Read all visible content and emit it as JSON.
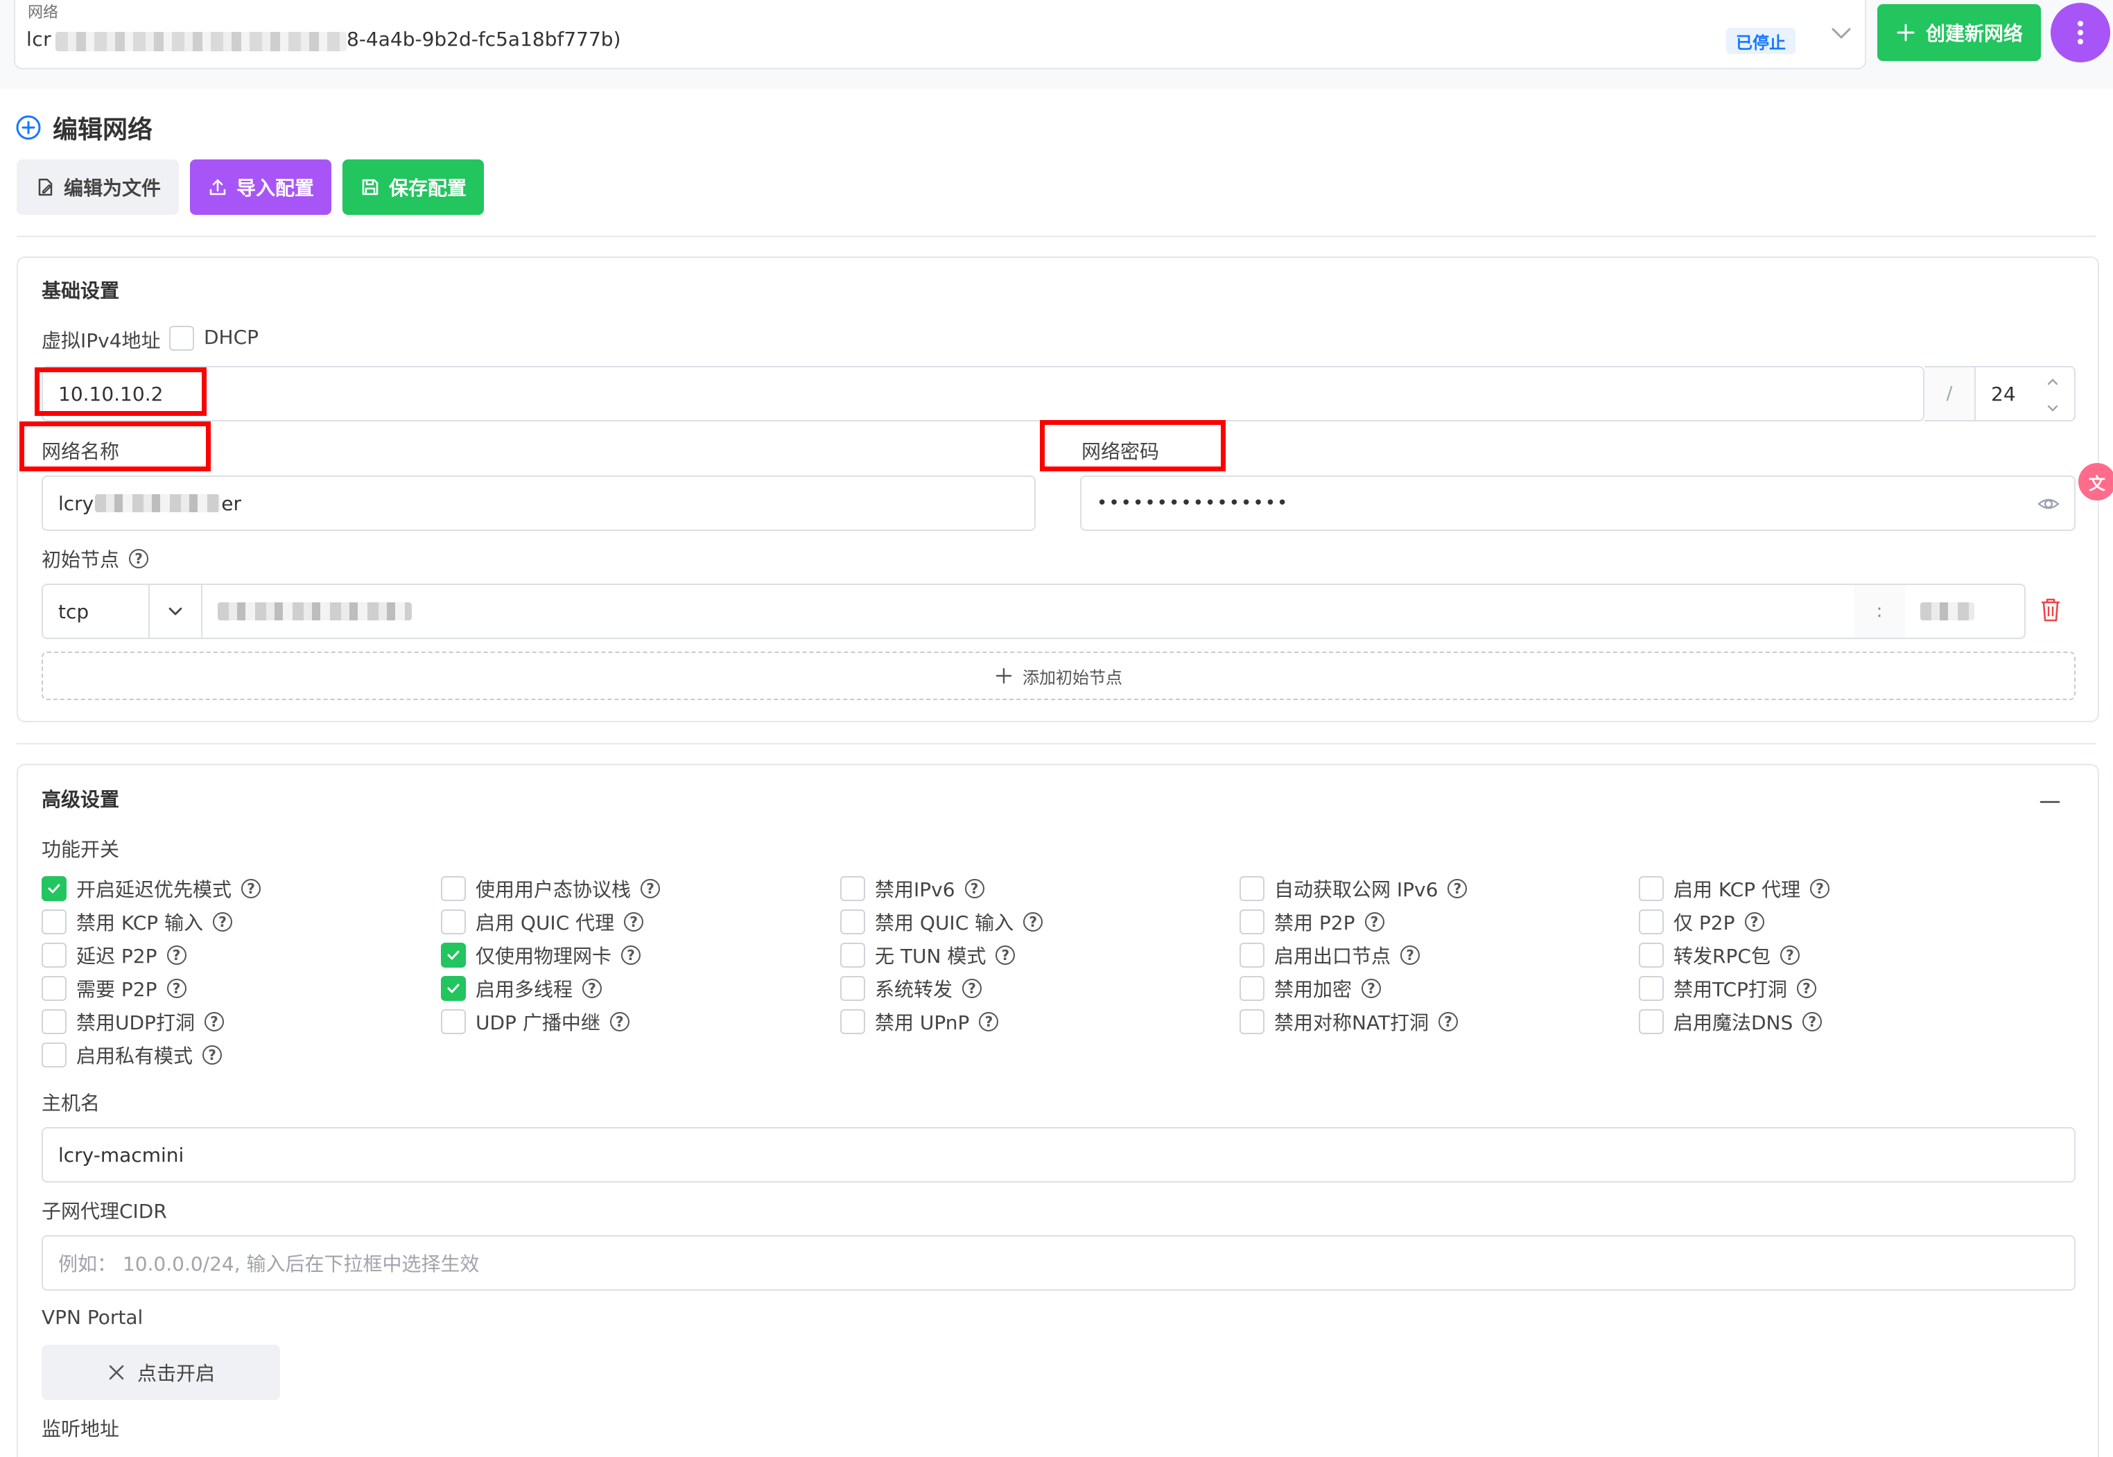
{
  "network_bar": {
    "label": "网络",
    "value_prefix": "lcr",
    "value_suffix": "8-4a4b-9b2d-fc5a18bf777b)",
    "status": "已停止",
    "create_button": "创建新网络"
  },
  "edit": {
    "title": "编辑网络",
    "edit_as_file": "编辑为文件",
    "import_config": "导入配置",
    "save_config": "保存配置"
  },
  "basic": {
    "title": "基础设置",
    "ipv4_label": "虚拟IPv4地址",
    "dhcp_label": "DHCP",
    "ipv4_value": "10.10.10.2",
    "slash": "/",
    "prefix_value": "24",
    "network_name_label": "网络名称",
    "network_name_prefix": "lcry",
    "network_name_suffix": "er",
    "network_password_label": "网络密码",
    "network_password_value": "••••••••••••••••",
    "initial_node_label": "初始节点",
    "protocol_value": "tcp",
    "colon": ":",
    "add_node": "添加初始节点"
  },
  "advanced": {
    "title": "高级设置",
    "feature_label": "功能开关",
    "features": [
      {
        "label": "开启延迟优先模式",
        "checked": true
      },
      {
        "label": "使用用户态协议栈",
        "checked": false
      },
      {
        "label": "禁用IPv6",
        "checked": false
      },
      {
        "label": "自动获取公网 IPv6",
        "checked": false
      },
      {
        "label": "启用 KCP 代理",
        "checked": false
      },
      {
        "label": "禁用 KCP 输入",
        "checked": false
      },
      {
        "label": "启用 QUIC 代理",
        "checked": false
      },
      {
        "label": "禁用 QUIC 输入",
        "checked": false
      },
      {
        "label": "禁用 P2P",
        "checked": false
      },
      {
        "label": "仅 P2P",
        "checked": false
      },
      {
        "label": "延迟 P2P",
        "checked": false
      },
      {
        "label": "仅使用物理网卡",
        "checked": true
      },
      {
        "label": "无 TUN 模式",
        "checked": false
      },
      {
        "label": "启用出口节点",
        "checked": false
      },
      {
        "label": "转发RPC包",
        "checked": false
      },
      {
        "label": "需要 P2P",
        "checked": false
      },
      {
        "label": "启用多线程",
        "checked": true
      },
      {
        "label": "系统转发",
        "checked": false
      },
      {
        "label": "禁用加密",
        "checked": false
      },
      {
        "label": "禁用TCP打洞",
        "checked": false
      },
      {
        "label": "禁用UDP打洞",
        "checked": false
      },
      {
        "label": "UDP 广播中继",
        "checked": false
      },
      {
        "label": "禁用 UPnP",
        "checked": false
      },
      {
        "label": "禁用对称NAT打洞",
        "checked": false
      },
      {
        "label": "启用魔法DNS",
        "checked": false
      },
      {
        "label": "启用私有模式",
        "checked": false
      }
    ],
    "hostname_label": "主机名",
    "hostname_value": "lcry-macmini",
    "cidr_label": "子网代理CIDR",
    "cidr_placeholder": "例如： 10.0.0.0/24, 输入后在下拉框中选择生效",
    "vpn_label": "VPN Portal",
    "vpn_button": "点击开启",
    "listen_label": "监听地址"
  },
  "colors": {
    "green": "#22c55e",
    "purple": "#a855f7",
    "blue": "#1677ff",
    "red_highlight": "#ff0000"
  }
}
